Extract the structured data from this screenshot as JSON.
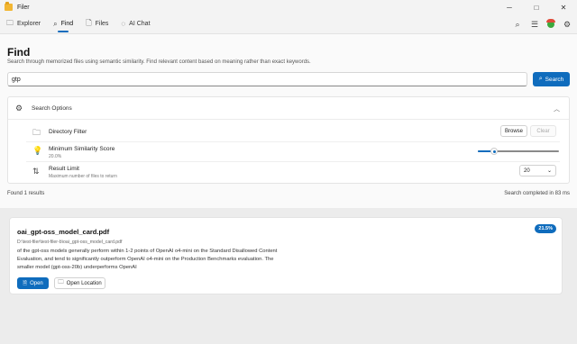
{
  "window": {
    "title": "Filer",
    "minimize_glyph": "─",
    "maximize_glyph": "□",
    "close_glyph": "✕"
  },
  "nav": {
    "tabs": [
      {
        "label": "Explorer",
        "icon": "folder-icon",
        "active": false
      },
      {
        "label": "Find",
        "icon": "search-icon",
        "active": true
      },
      {
        "label": "Files",
        "icon": "document-icon",
        "active": false
      },
      {
        "label": "AI Chat",
        "icon": "chat-icon",
        "active": false
      }
    ],
    "right_icons": [
      "search-icon",
      "menu-icon",
      "status-icon",
      "gear-icon"
    ]
  },
  "find": {
    "title": "Find",
    "subtitle": "Search through memorized files using semantic similarity. Find relevant content based on meaning rather than exact keywords.",
    "query": "gtp",
    "search_label": "Search"
  },
  "options": {
    "header_label": "Search Options",
    "directory_filter": {
      "label": "Directory Filter",
      "browse_label": "Browse",
      "clear_label": "Clear"
    },
    "similarity": {
      "label": "Minimum Similarity Score",
      "value_text": "20.0%",
      "value": 0.2
    },
    "result_limit": {
      "label": "Result Limit",
      "description": "Maximum number of files to return",
      "value": "20"
    }
  },
  "summary": {
    "found_text": "Found 1 results",
    "completed_text": "Search completed in 83 ms"
  },
  "results": [
    {
      "filename": "oai_gpt-oss_model_card.pdf",
      "path": "D:\\test-filer\\test-filer-b\\oai_gpt-oss_model_card.pdf",
      "snippet": "of the gpt-oss models generally perform within 1-2 points of OpenAI o4-mini on the Standard Disallowed Content Evaluation, and tend to significantly outperform OpenAI o4-mini on the Production Benchmarks evaluation. The smaller model (gpt-oss-20b) underperforms OpenAI",
      "score": "21.5%",
      "open_label": "Open",
      "open_location_label": "Open Location"
    }
  ],
  "colors": {
    "accent": "#0f6cbd",
    "panel_bg": "#fafafa",
    "results_bg": "#ececec"
  }
}
